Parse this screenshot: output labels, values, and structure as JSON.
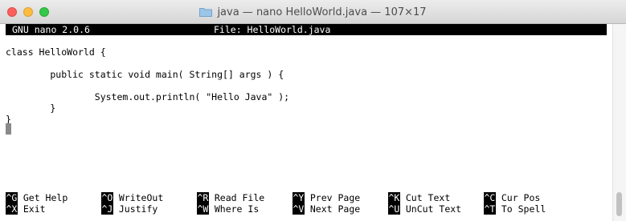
{
  "window": {
    "title": "java — nano HelloWorld.java — 107×17",
    "title_icon": "folder-icon"
  },
  "nano": {
    "version": "GNU nano 2.0.6",
    "file_label": "File: HelloWorld.java"
  },
  "code_lines": [
    "",
    "class HelloWorld {",
    "",
    "        public static void main( String[] args ) {",
    "",
    "                System.out.println( \"Hello Java\" );",
    "        }",
    "}"
  ],
  "shortcuts": [
    {
      "key": "^G",
      "label": "Get Help"
    },
    {
      "key": "^O",
      "label": "WriteOut"
    },
    {
      "key": "^R",
      "label": "Read File"
    },
    {
      "key": "^Y",
      "label": "Prev Page"
    },
    {
      "key": "^K",
      "label": "Cut Text"
    },
    {
      "key": "^C",
      "label": "Cur Pos"
    },
    {
      "key": "^X",
      "label": "Exit"
    },
    {
      "key": "^J",
      "label": "Justify"
    },
    {
      "key": "^W",
      "label": "Where Is"
    },
    {
      "key": "^V",
      "label": "Next Page"
    },
    {
      "key": "^U",
      "label": "UnCut Text"
    },
    {
      "key": "^T",
      "label": "To Spell"
    }
  ],
  "colors": {
    "close": "#fc605c",
    "minimize": "#fdbc40",
    "maximize": "#34c84a",
    "folder": "#9cc6e8"
  }
}
